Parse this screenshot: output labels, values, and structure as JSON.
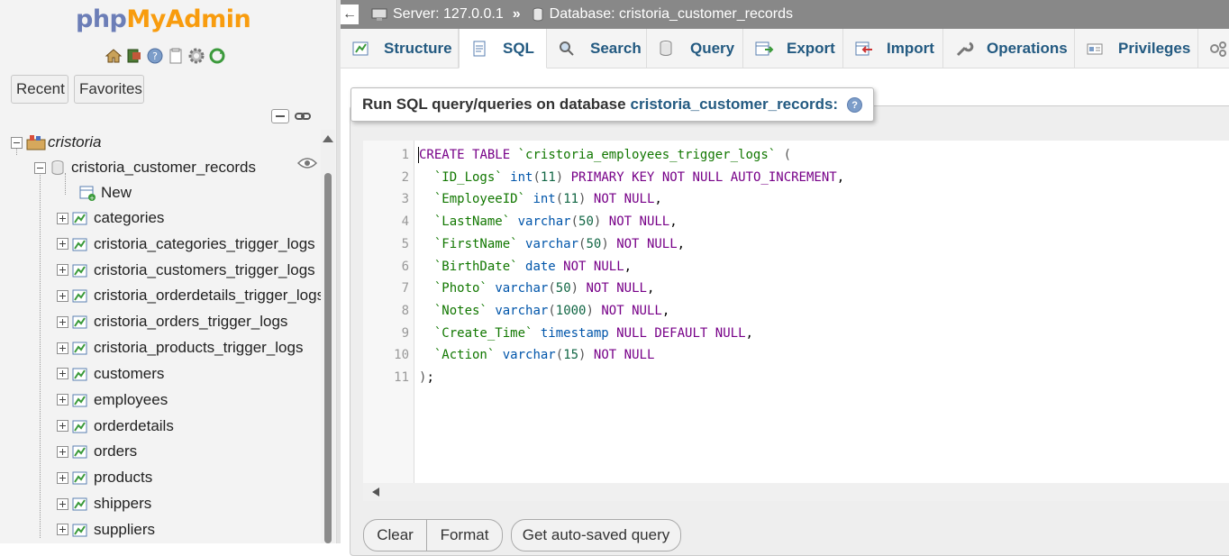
{
  "logo": {
    "php": "php",
    "myadmin": "MyAdmin"
  },
  "nav": {
    "recent_label": "Recent",
    "favorites_label": "Favorites",
    "server_node": "cristoria",
    "database_node": "cristoria_customer_records",
    "new_label": "New",
    "tables": [
      "categories",
      "cristoria_categories_trigger_logs",
      "cristoria_customers_trigger_logs",
      "cristoria_orderdetails_trigger_logs",
      "cristoria_orders_trigger_logs",
      "cristoria_products_trigger_logs",
      "customers",
      "employees",
      "orderdetails",
      "orders",
      "products",
      "shippers",
      "suppliers"
    ]
  },
  "breadcrumb": {
    "server": "Server: 127.0.0.1",
    "separator": "»",
    "database": "Database: cristoria_customer_records"
  },
  "tabs": [
    "Structure",
    "SQL",
    "Search",
    "Query",
    "Export",
    "Import",
    "Operations",
    "Privileges"
  ],
  "active_tab": "SQL",
  "sql_panel": {
    "legend_prefix": "Run SQL query/queries on database",
    "legend_db": "cristoria_customer_records:"
  },
  "code_lines": [
    "CREATE TABLE `cristoria_employees_trigger_logs` (",
    "  `ID_Logs` int(11) PRIMARY KEY NOT NULL AUTO_INCREMENT,",
    "  `EmployeeID` int(11) NOT NULL,",
    "  `LastName` varchar(50) NOT NULL,",
    "  `FirstName` varchar(50) NOT NULL,",
    "  `BirthDate` date NOT NULL,",
    "  `Photo` varchar(50) NOT NULL,",
    "  `Notes` varchar(1000) NOT NULL,",
    "  `Create_Time` timestamp NULL DEFAULT NULL,",
    "  `Action` varchar(15) NOT NULL",
    ");"
  ],
  "buttons": {
    "clear": "Clear",
    "format": "Format",
    "autosaved": "Get auto-saved query"
  },
  "colors": {
    "link": "#235a81",
    "keyword": "#770088",
    "type": "#0055aa",
    "string": "#117700",
    "topbar": "#888888"
  }
}
